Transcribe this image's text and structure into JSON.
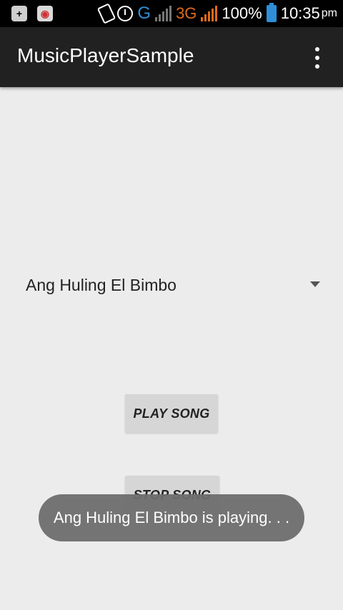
{
  "status_bar": {
    "left_icons": [
      "add-notification-icon",
      "chat-app-icon"
    ],
    "network_g": "G",
    "network_3g": "3G",
    "battery_percent": "100%",
    "time": "10:35",
    "time_suffix": "pm"
  },
  "app_bar": {
    "title": "MusicPlayerSample",
    "overflow_icon": "more-vert-icon"
  },
  "spinner": {
    "selected": "Ang Huling El Bimbo"
  },
  "buttons": {
    "play": "PLAY SONG",
    "stop": "STOP SONG"
  },
  "toast": {
    "message": "Ang Huling El Bimbo is playing. . ."
  },
  "colors": {
    "app_bar": "#212121",
    "background": "#ececec",
    "network_g": "#2e8fd8",
    "network_3g": "#e06a1c",
    "battery": "#2e8fd8"
  }
}
